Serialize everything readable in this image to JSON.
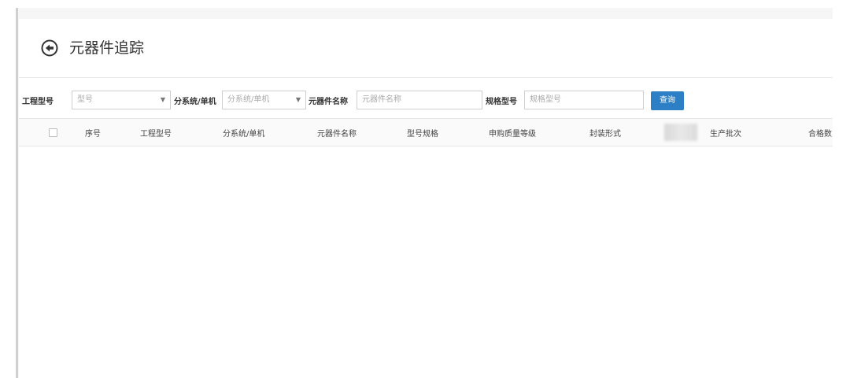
{
  "page": {
    "title": "元器件追踪"
  },
  "filters": {
    "project_model": {
      "label": "工程型号",
      "placeholder": "型号"
    },
    "subsystem": {
      "label": "分系统/单机",
      "placeholder": "分系统/单机"
    },
    "component_name": {
      "label": "元器件名称",
      "placeholder": "元器件名称"
    },
    "spec_model": {
      "label": "规格型号",
      "placeholder": "规格型号"
    },
    "query_button": "查询"
  },
  "table": {
    "columns": [
      "序号",
      "工程型号",
      "分系统/单机",
      "元器件名称",
      "型号规格",
      "申购质量等级",
      "封装形式",
      "",
      "生产批次",
      "合格数"
    ]
  },
  "icons": {
    "back": "back-circle-arrow-icon",
    "dropdown": "caret-down-icon"
  },
  "colors": {
    "accent": "#2c7fc4",
    "border": "#cfcfcf",
    "background_frame": "#f6f6f6"
  }
}
